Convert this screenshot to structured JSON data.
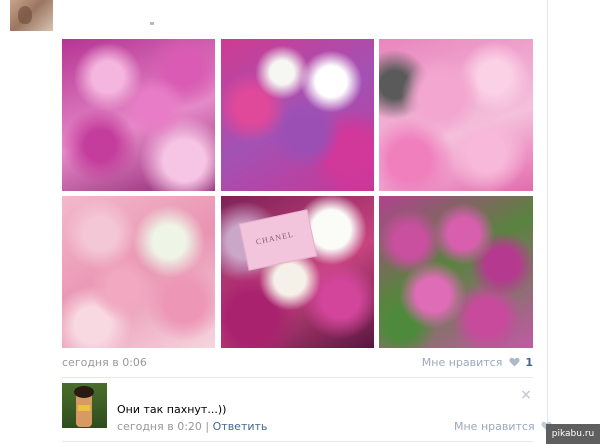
{
  "post": {
    "time": "сегодня в 0:06",
    "like_label": "Мне нравится",
    "like_count": "1",
    "photos": [
      {
        "icon": "peony-bouquet-photo"
      },
      {
        "icon": "mixed-roses-lilac-photo"
      },
      {
        "icon": "pink-peonies-photo"
      },
      {
        "icon": "pastel-ranunculus-photo"
      },
      {
        "icon": "chanel-roses-photo",
        "card_text": "CHANEL"
      },
      {
        "icon": "magenta-peony-buds-photo"
      }
    ]
  },
  "comment": {
    "text": "Они так пахнут...))",
    "time": "сегодня в 0:20",
    "separator": " | ",
    "reply_label": "Ответить",
    "like_label": "Мне нравится"
  },
  "watermark": "pikabu.ru",
  "colors": {
    "link": "#45688e",
    "meta": "#999999",
    "divider": "#e7e8ec"
  }
}
